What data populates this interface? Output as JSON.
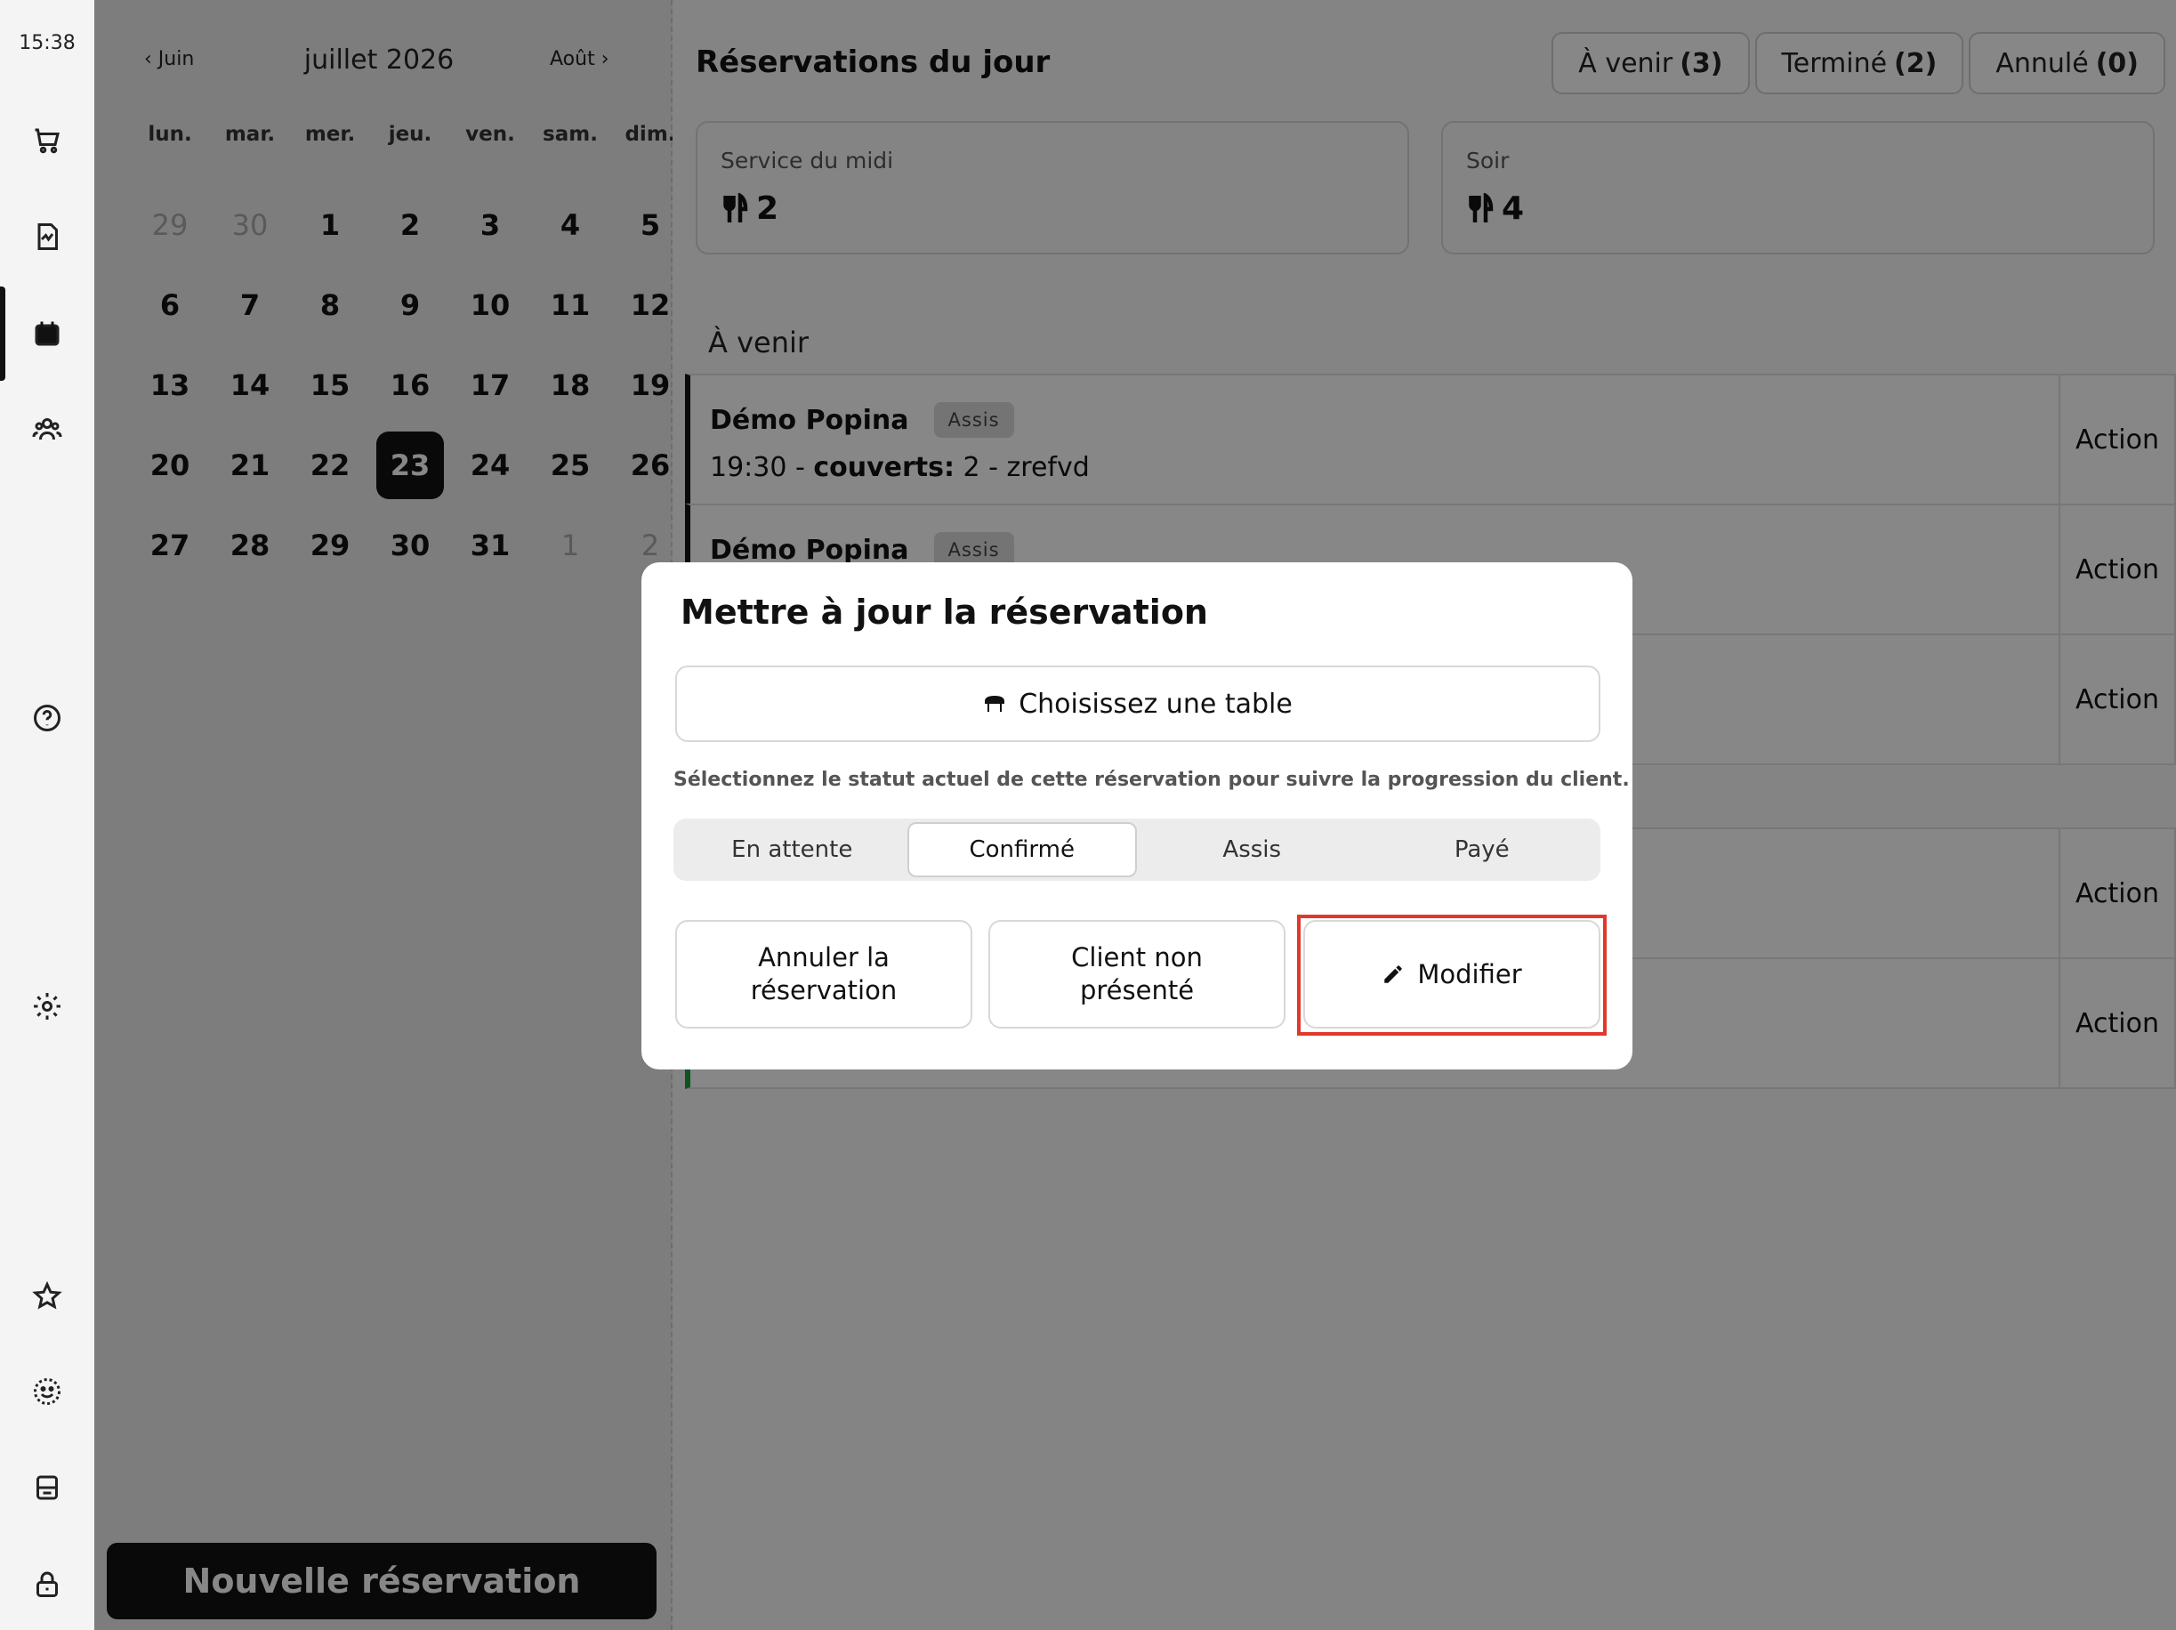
{
  "rail": {
    "time": "15:38",
    "icons": [
      "cart-icon",
      "receipt-icon",
      "calendar-icon",
      "users-icon",
      "help-icon",
      "gear-icon",
      "star-icon",
      "smile-icon",
      "printer-icon",
      "lock-icon"
    ]
  },
  "calendar": {
    "prev_label": "Juin",
    "title": "juillet 2026",
    "next_label": "Août",
    "weekdays": [
      "lun.",
      "mar.",
      "mer.",
      "jeu.",
      "ven.",
      "sam.",
      "dim."
    ],
    "days": [
      {
        "d": "29",
        "muted": true
      },
      {
        "d": "30",
        "muted": true
      },
      {
        "d": "1"
      },
      {
        "d": "2"
      },
      {
        "d": "3"
      },
      {
        "d": "4"
      },
      {
        "d": "5"
      },
      {
        "d": "6"
      },
      {
        "d": "7"
      },
      {
        "d": "8"
      },
      {
        "d": "9"
      },
      {
        "d": "10"
      },
      {
        "d": "11"
      },
      {
        "d": "12"
      },
      {
        "d": "13"
      },
      {
        "d": "14"
      },
      {
        "d": "15"
      },
      {
        "d": "16"
      },
      {
        "d": "17"
      },
      {
        "d": "18"
      },
      {
        "d": "19"
      },
      {
        "d": "20"
      },
      {
        "d": "21"
      },
      {
        "d": "22"
      },
      {
        "d": "23",
        "selected": true
      },
      {
        "d": "24"
      },
      {
        "d": "25"
      },
      {
        "d": "26"
      },
      {
        "d": "27"
      },
      {
        "d": "28"
      },
      {
        "d": "29"
      },
      {
        "d": "30"
      },
      {
        "d": "31"
      },
      {
        "d": "1",
        "muted": true
      },
      {
        "d": "2",
        "muted": true
      }
    ],
    "new_button": "Nouvelle réservation"
  },
  "main": {
    "title": "Réservations du jour",
    "filters": [
      {
        "label": "À venir",
        "count": "(3)"
      },
      {
        "label": "Terminé",
        "count": "(2)"
      },
      {
        "label": "Annulé",
        "count": "(0)"
      }
    ],
    "services": [
      {
        "label": "Service du midi",
        "value": "2"
      },
      {
        "label": "Soir",
        "value": "4"
      }
    ],
    "section_upcoming": "À venir",
    "reservations": [
      {
        "name": "Démo Popina",
        "badge": "Assis",
        "detail_prefix": "19:30 - ",
        "detail_bold": "couverts:",
        "detail_rest": " 2  - zrefvd",
        "action": "Action"
      },
      {
        "name": "Démo Popina",
        "badge": "Assis",
        "detail_prefix": "",
        "detail_bold": "",
        "detail_rest": "",
        "action": "Action"
      },
      {
        "name": "",
        "badge": "",
        "detail_prefix": "",
        "detail_bold": "",
        "detail_rest": "",
        "action": "Action"
      },
      {
        "name": "",
        "badge": "",
        "detail_prefix": "",
        "detail_bold": "",
        "detail_rest": "",
        "action": "Action"
      },
      {
        "name": "",
        "badge": "",
        "detail_prefix": "",
        "detail_bold": "",
        "detail_rest": "",
        "action": "Action"
      }
    ]
  },
  "modal": {
    "title": "Mettre à jour la réservation",
    "table_button": "Choisissez une table",
    "hint": "Sélectionnez le statut actuel de cette réservation pour suivre la progression du client.",
    "statuses": [
      "En attente",
      "Confirmé",
      "Assis",
      "Payé"
    ],
    "active_status": "Confirmé",
    "cancel_button": "Annuler la réservation",
    "noshow_button": "Client non présenté",
    "modify_button": "Modifier"
  }
}
